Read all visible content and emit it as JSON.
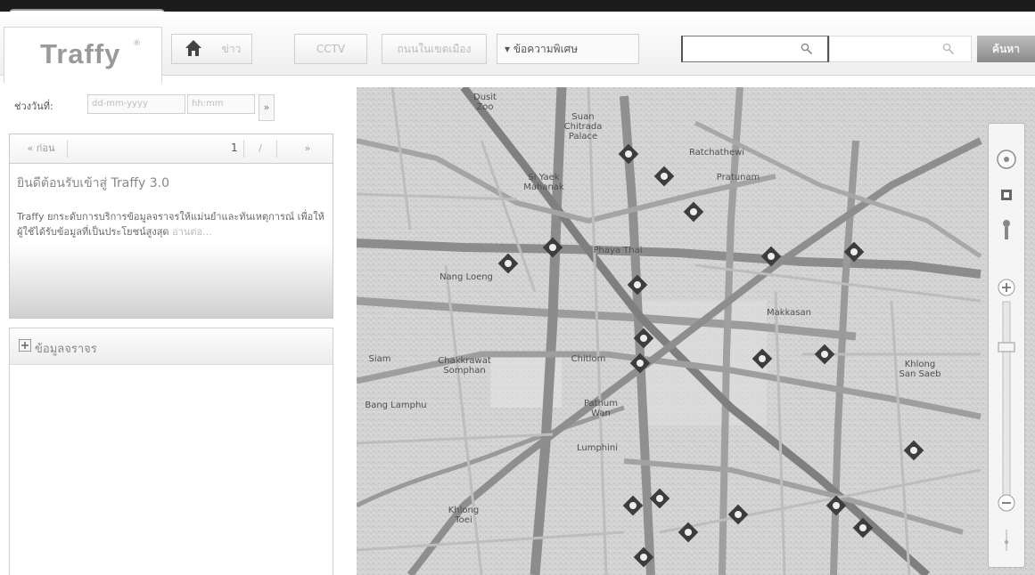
{
  "app": {
    "logo": "Traffy",
    "logo_sup": "®"
  },
  "toolbar": {
    "home_label": "",
    "nav_items": [
      "ข่าว",
      "CCTV",
      "ถนนในเขตเมือง"
    ],
    "dropdown_label": "▾ ข้อความพิเศษ",
    "search_value": "",
    "search2_value": "",
    "go_label": "ค้นหา"
  },
  "sidebar": {
    "date_label": "ช่วงวันที่:",
    "date_from": "dd-mm-yyyy",
    "date_to": "hh:mm",
    "date_go": "»",
    "pager": {
      "prev": "« ก่อน",
      "count": "1",
      "slash": "/",
      "next": "»"
    },
    "news": {
      "title": "ยินดีต้อนรับเข้าสู่ Traffy 3.0",
      "body": "Traffy ยกระดับการบริการข้อมูลจราจรให้แม่นยำและทันเหตุการณ์ เพื่อให้ผู้ใช้ได้รับข้อมูลที่เป็นประโยชน์สูงสุด",
      "more": "อ่านต่อ..."
    },
    "info_title": "ข้อมูลจราจร"
  },
  "map": {
    "labels": [
      "Dusit\nZoo",
      "Suan\nChitrada\nPalace",
      "Si Yaek\nMahanak",
      "Ratchathewi",
      "Phaya Thai",
      "Makkasan",
      "Pratunam",
      "Nang Loeng",
      "Chakkrawat\nSomphan",
      "Bang Lamphu",
      "Pathum\nWan",
      "Chitlom",
      "Khlong\nSan Saeb",
      "Khlong\nToei",
      "Lumphini",
      "Siam"
    ],
    "zoom_label": "Zoom"
  }
}
